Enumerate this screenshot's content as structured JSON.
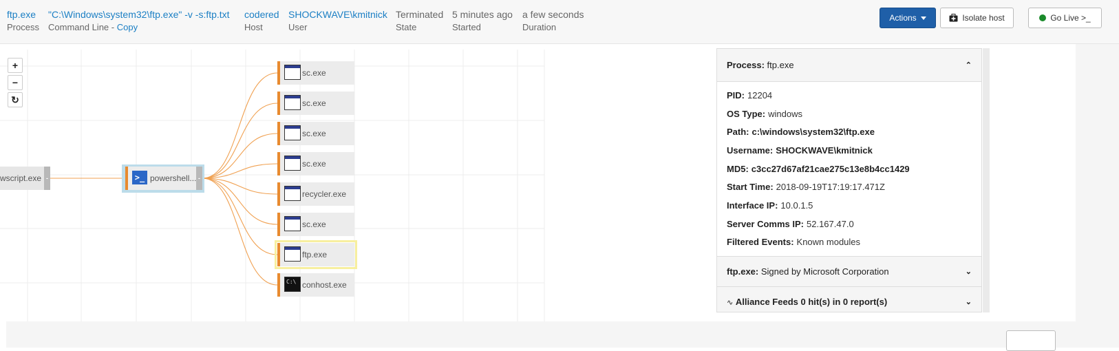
{
  "header": {
    "process": {
      "value": "ftp.exe",
      "label": "Process"
    },
    "command": {
      "value": "\"C:\\Windows\\system32\\ftp.exe\" -v -s:ftp.txt",
      "label": "Command Line - ",
      "copy": "Copy"
    },
    "host": {
      "value": "codered",
      "label": "Host"
    },
    "user": {
      "value": "SHOCKWAVE\\kmitnick",
      "label": "User"
    },
    "state": {
      "value": "Terminated",
      "label": "State"
    },
    "started": {
      "value": "5 minutes ago",
      "label": "Started"
    },
    "duration": {
      "value": "a few seconds",
      "label": "Duration"
    },
    "buttons": {
      "actions": "Actions",
      "isolate": "Isolate host",
      "golive": "Go Live >_"
    }
  },
  "graph": {
    "zoom_in": "+",
    "zoom_out": "−",
    "refresh": "↻",
    "parent_node": "wscript.exe",
    "main_node": "powershell....",
    "tail_glyph": "-",
    "children": [
      {
        "label": "sc.exe",
        "icon": "window-icon",
        "selected": false
      },
      {
        "label": "sc.exe",
        "icon": "window-icon",
        "selected": false
      },
      {
        "label": "sc.exe",
        "icon": "window-icon",
        "selected": false
      },
      {
        "label": "sc.exe",
        "icon": "window-icon",
        "selected": false
      },
      {
        "label": "recycler.exe",
        "icon": "window-icon",
        "selected": false
      },
      {
        "label": "sc.exe",
        "icon": "window-icon",
        "selected": false
      },
      {
        "label": "ftp.exe",
        "icon": "window-icon",
        "selected": true
      },
      {
        "label": "conhost.exe",
        "icon": "console-icon",
        "selected": false
      }
    ],
    "colors": {
      "edge": "#f0a050",
      "selected": "#f7ef9f",
      "main_highlight": "#bcdcea"
    }
  },
  "panel": {
    "title_key": "Process:",
    "title_val": "ftp.exe",
    "fields": [
      {
        "key": "PID:",
        "val": "12204",
        "bold": false
      },
      {
        "key": "OS Type:",
        "val": "windows",
        "bold": false
      },
      {
        "key": "Path:",
        "val": "c:\\windows\\system32\\ftp.exe",
        "bold": true
      },
      {
        "key": "Username:",
        "val": "SHOCKWAVE\\kmitnick",
        "bold": true
      },
      {
        "key": "MD5:",
        "val": "c3cc27d67af21cae275c13e8b4cc1429",
        "bold": true
      },
      {
        "key": "Start Time:",
        "val": "2018-09-19T17:19:17.471Z",
        "bold": false
      },
      {
        "key": "Interface IP:",
        "val": "10.0.1.5",
        "bold": false
      },
      {
        "key": "Server Comms IP:",
        "val": "52.167.47.0",
        "bold": false
      },
      {
        "key": "Filtered Events:",
        "val": "Known modules",
        "bold": false
      }
    ],
    "signed": {
      "key": "ftp.exe:",
      "val": "Signed by Microsoft Corporation"
    },
    "feeds": {
      "label": "Alliance Feeds 0 hit(s) in 0 report(s)"
    }
  }
}
